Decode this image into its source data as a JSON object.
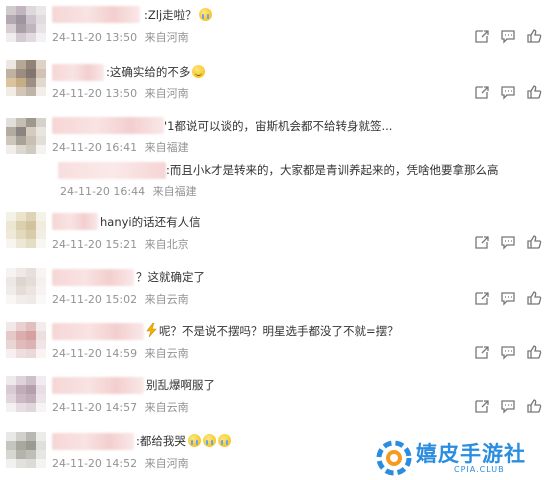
{
  "comments": [
    {
      "text": ":Zlj走啦？",
      "emoji": "cry",
      "date": "24-11-20 13:50",
      "location": "来自河南",
      "has_actions": true
    },
    {
      "text": ":这确实给的不多",
      "emoji": "smile",
      "date": "24-11-20 13:50",
      "location": "来自河南",
      "has_actions": true
    },
    {
      "text": "'1都说可以谈的，宙斯机会都不给转身就签...",
      "date": "24-11-20 16:41",
      "location": "来自福建",
      "has_actions": false
    },
    {
      "text": ":而且小k才是转来的，大家都是青训养起来的，凭啥他要拿那么高",
      "date": "24-11-20 16:44",
      "location": "来自福建",
      "has_actions": false,
      "reply": true
    },
    {
      "text": "hanyi的话还有人信",
      "date": "24-11-20 15:21",
      "location": "来自北京",
      "has_actions": true
    },
    {
      "text": "？这就确定了",
      "date": "24-11-20 15:02",
      "location": "来自云南",
      "has_actions": true
    },
    {
      "text": "呢？不是说不摆吗？明星选手都没了不就=摆？",
      "date": "24-11-20 14:59",
      "location": "来自云南",
      "has_actions": true,
      "lightning": true
    },
    {
      "text": "别乱爆啊服了",
      "date": "24-11-20 14:57",
      "location": "来自云南",
      "has_actions": true
    },
    {
      "text": ":都给我哭",
      "emoji": "cry3",
      "date": "24-11-20 14:52",
      "location": "来自河南",
      "has_actions": true
    }
  ],
  "watermark": {
    "title": "嬉皮手游社",
    "subtitle": "CPIA.CLUB"
  },
  "colors": {
    "meta": "#939393",
    "text": "#333333",
    "accent": "#2a8de0"
  }
}
